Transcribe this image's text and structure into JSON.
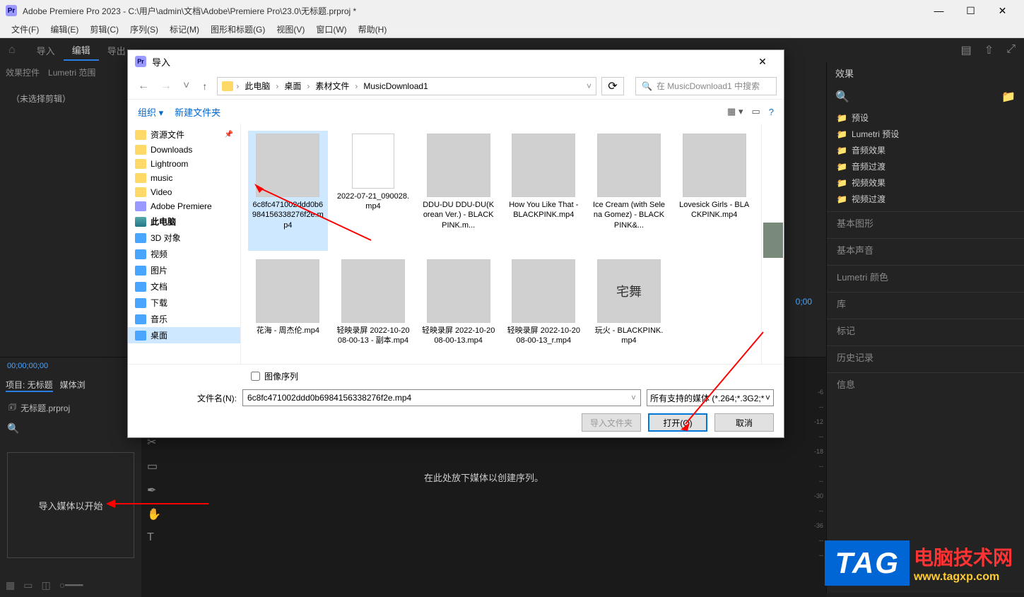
{
  "window": {
    "title": "Adobe Premiere Pro 2023 - C:\\用户\\admin\\文档\\Adobe\\Premiere Pro\\23.0\\无标题.prproj *"
  },
  "menu": [
    "文件(F)",
    "编辑(E)",
    "剪辑(C)",
    "序列(S)",
    "标记(M)",
    "图形和标题(G)",
    "视图(V)",
    "窗口(W)",
    "帮助(H)"
  ],
  "workspace_tabs": {
    "items": [
      "导入",
      "编辑",
      "导出"
    ],
    "active": 1
  },
  "left_panel": {
    "tabs": [
      "效果控件",
      "Lumetri 范围"
    ],
    "no_clip": "（未选择剪辑）"
  },
  "right_panel": {
    "header": "效果",
    "tree": [
      "预设",
      "Lumetri 预设",
      "音频效果",
      "音频过渡",
      "视频效果",
      "视频过渡"
    ],
    "sections": [
      "基本图形",
      "基本声音",
      "Lumetri 颜色",
      "库",
      "标记",
      "历史记录",
      "信息"
    ]
  },
  "project_panel": {
    "tabs": {
      "project": "项目: 无标题",
      "media": "媒体浏"
    },
    "bin": "无标题.prproj",
    "dropzone": "导入媒体以开始",
    "timecode": "00;00;00;00"
  },
  "timeline": {
    "placeholder": "在此处放下媒体以创建序列。",
    "timecode": "0;00"
  },
  "ruler_ticks": [
    "-6",
    "--",
    "-12",
    "--",
    "-18",
    "--",
    "--",
    "-30",
    "--",
    "-36",
    "--",
    "--"
  ],
  "dialog": {
    "title": "导入",
    "breadcrumb": [
      "此电脑",
      "桌面",
      "素材文件",
      "MusicDownload1"
    ],
    "search_placeholder": "在 MusicDownload1 中搜索",
    "toolbar": {
      "organize": "组织",
      "new_folder": "新建文件夹"
    },
    "tree": [
      {
        "icon": "folder",
        "label": "资源文件",
        "pinned": true
      },
      {
        "icon": "folder",
        "label": "Downloads"
      },
      {
        "icon": "folder",
        "label": "Lightroom"
      },
      {
        "icon": "folder",
        "label": "music"
      },
      {
        "icon": "folder",
        "label": "Video"
      },
      {
        "icon": "pr",
        "label": "Adobe Premiere"
      },
      {
        "icon": "pc",
        "label": "此电脑",
        "bold": true
      },
      {
        "icon": "blue",
        "label": "3D 对象"
      },
      {
        "icon": "blue",
        "label": "视频"
      },
      {
        "icon": "blue",
        "label": "图片"
      },
      {
        "icon": "blue",
        "label": "文档"
      },
      {
        "icon": "blue",
        "label": "下载"
      },
      {
        "icon": "blue",
        "label": "音乐"
      },
      {
        "icon": "blue",
        "label": "桌面",
        "selected": true
      }
    ],
    "files": [
      {
        "name": "6c8fc471002ddd0b6984156338276f2e.mp4",
        "thumb": "t-green",
        "selected": true
      },
      {
        "name": "2022-07-21_090028.mp4",
        "thumb": "doc"
      },
      {
        "name": "DDU-DU DDU-DU(Korean Ver.) - BLACKPINK.m...",
        "thumb": "t-pink1"
      },
      {
        "name": "How You Like That - BLACKPINK.mp4",
        "thumb": "t-pink2"
      },
      {
        "name": "Ice Cream (with Selena Gomez) - BLACKPINK&...",
        "thumb": "t-crown"
      },
      {
        "name": "Lovesick Girls - BLACKPINK.mp4",
        "thumb": "t-crown2"
      },
      {
        "name": "花海 - 周杰伦.mp4",
        "thumb": "t-sunset"
      },
      {
        "name": "轻映录屏 2022-10-20 08-00-13 - 副本.mp4",
        "thumb": "t-flower"
      },
      {
        "name": "轻映录屏 2022-10-20 08-00-13.mp4",
        "thumb": "t-flower"
      },
      {
        "name": "轻映录屏 2022-10-20 08-00-13_r.mp4",
        "thumb": "t-flower"
      },
      {
        "name": "玩火 - BLACKPINK.mp4",
        "thumb": "t-white",
        "text": "宅舞"
      }
    ],
    "image_sequence": "图像序列",
    "filename_label": "文件名(N):",
    "filename_value": "6c8fc471002ddd0b6984156338276f2e.mp4",
    "filter": "所有支持的媒体 (*.264;*.3G2;*",
    "buttons": {
      "import_folder": "导入文件夹",
      "open": "打开(O)",
      "cancel": "取消"
    }
  },
  "watermark": {
    "tag": "TAG",
    "line1": "电脑技术网",
    "line2": "www.tagxp.com"
  }
}
